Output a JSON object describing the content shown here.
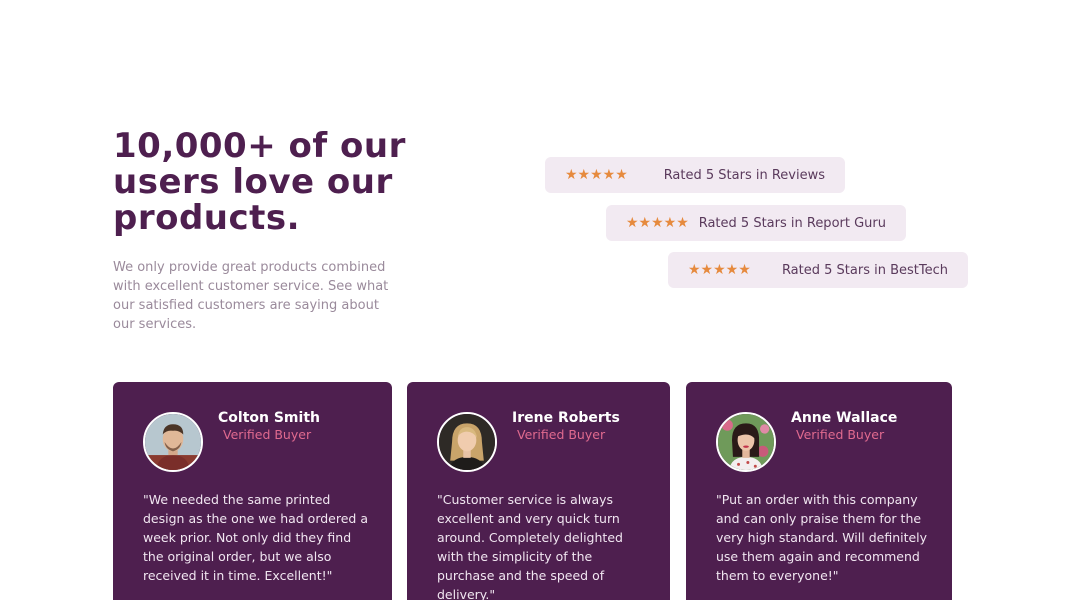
{
  "hero": {
    "heading": "10,000+ of our users love our products.",
    "intro": "We only provide great products combined with excellent customer service. See what our satisfied customers are saying about our services."
  },
  "ratings": [
    {
      "stars": "★★★★★",
      "label": "Rated 5 Stars in Reviews",
      "rating_value": 5
    },
    {
      "stars": "★★★★★",
      "label": "Rated 5 Stars in Report Guru",
      "rating_value": 5
    },
    {
      "stars": "★★★★★",
      "label": "Rated 5 Stars in BestTech",
      "rating_value": 5
    }
  ],
  "testimonials": [
    {
      "name": "Colton Smith",
      "badge": "Verified Buyer",
      "quote": "\"We needed the same printed design as the one we had ordered a week prior. Not only did they find the original order, but we also received it in time. Excellent!\""
    },
    {
      "name": "Irene Roberts",
      "badge": "Verified Buyer",
      "quote": "\"Customer service is always excellent and very quick turn around. Completely delighted with the simplicity of the purchase and the speed of delivery.\""
    },
    {
      "name": "Anne Wallace",
      "badge": "Verified Buyer",
      "quote": "\"Put an order with this company and can only praise them for the very high standard. Will definitely use them again and recommend them to everyone!\""
    }
  ],
  "colors": {
    "primary": "#4e1f4f",
    "star": "#e68a3e",
    "accent": "#e06a8f",
    "rating_bg": "#f2eaf2"
  }
}
